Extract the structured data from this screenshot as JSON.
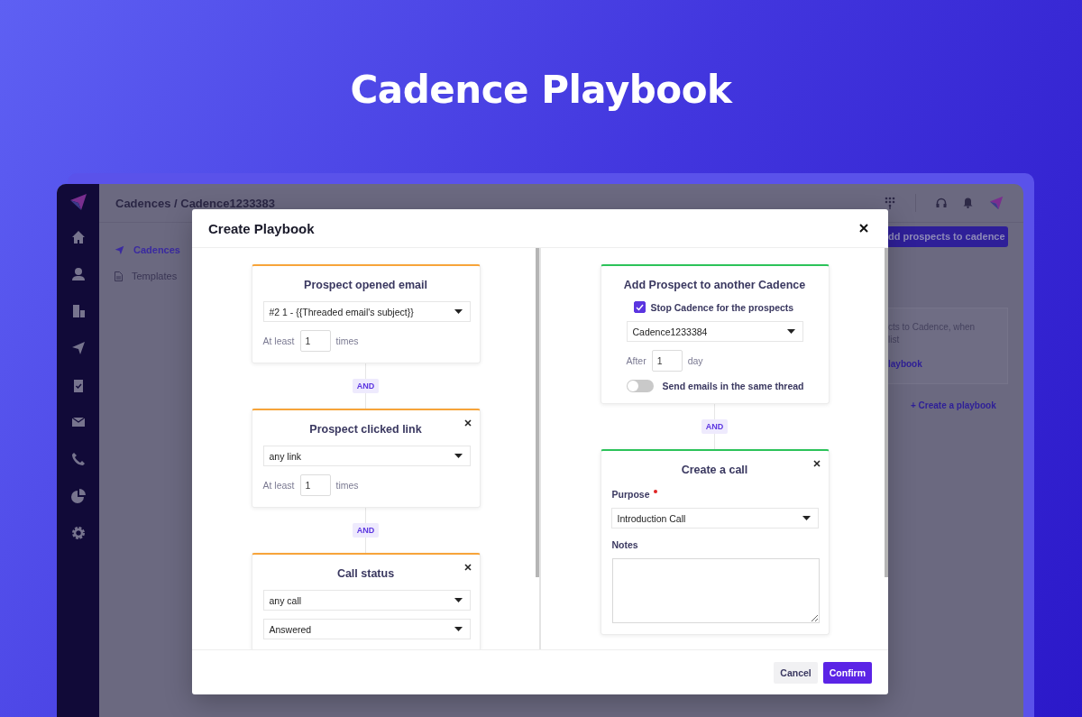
{
  "banner": {
    "title": "Cadence Playbook"
  },
  "app": {
    "breadcrumb": "Cadences / Cadence1233383",
    "nav": [
      {
        "label": "Cadences",
        "selected": true
      },
      {
        "label": "Templates",
        "selected": false
      }
    ],
    "add_button": "dd prospects to cadence",
    "info_card": {
      "lines": [
        "cts to Cadence, when",
        "list"
      ],
      "link": "laybook"
    },
    "create_link": "+ Create a playbook"
  },
  "modal": {
    "title": "Create Playbook",
    "conditions": [
      {
        "kind": "count",
        "title": "Prospect opened email",
        "closable": false,
        "select": "#2 1 - {{Threaded email's subject}}",
        "count_label": "At least",
        "count": "1",
        "unit": "times"
      },
      {
        "kind": "count",
        "join": "AND",
        "title": "Prospect clicked link",
        "closable": true,
        "select": "any link",
        "count_label": "At least",
        "count": "1",
        "unit": "times"
      },
      {
        "kind": "status",
        "join": "AND",
        "title": "Call status",
        "closable": true,
        "selects": [
          "any call",
          "Answered"
        ]
      }
    ],
    "actions": [
      {
        "kind": "move",
        "title": "Add Prospect to another Cadence",
        "closable": false,
        "checkbox": {
          "label": "Stop Cadence for the prospects",
          "checked": true
        },
        "select": "Cadence1233384",
        "delay_label": "After",
        "delay": "1",
        "unit": "day",
        "toggle": {
          "label": "Send emails in the same thread",
          "on": false
        }
      },
      {
        "kind": "call",
        "join": "AND",
        "title": "Create a call",
        "closable": true,
        "purpose_label": "Purpose",
        "required": true,
        "select": "Introduction Call",
        "notes_label": "Notes"
      }
    ],
    "buttons": [
      {
        "label": "Cancel",
        "kind": "secondary"
      },
      {
        "label": "Confirm",
        "kind": "primary"
      }
    ]
  }
}
